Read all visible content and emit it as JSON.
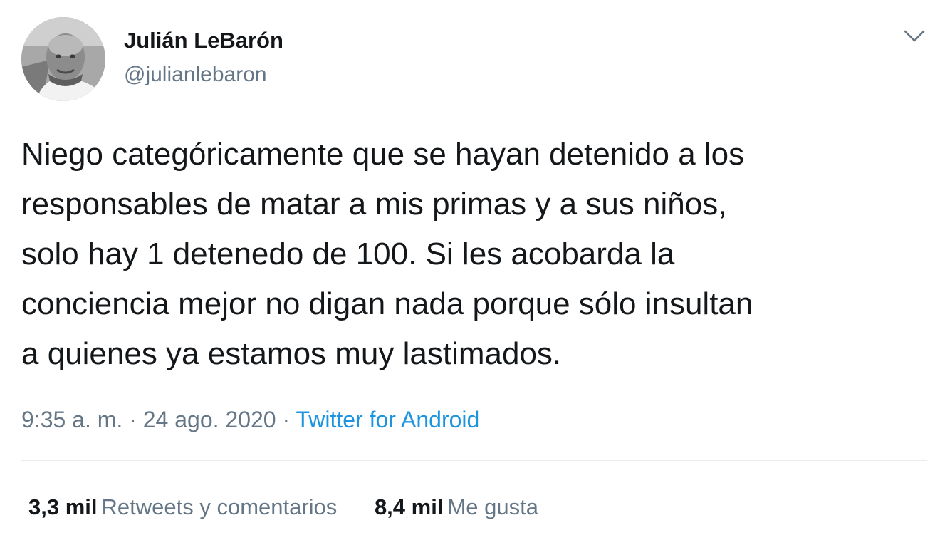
{
  "user": {
    "display_name": "Julián LeBarón",
    "handle": "@julianlebaron",
    "avatar": "profile-photo-grayscale"
  },
  "menu_icon": "chevron-down-icon",
  "tweet": {
    "text": "Niego categóricamente que se hayan detenido a los\nresponsables de matar a mis primas y a sus niños,\nsolo hay 1 detenedo de 100. Si les acobarda la\nconciencia mejor no digan nada porque sólo insultan\na quienes ya estamos muy lastimados."
  },
  "meta": {
    "time": "9:35 a. m.",
    "separator": " · ",
    "date": "24 ago. 2020",
    "source": "Twitter for Android"
  },
  "stats": {
    "retweets": {
      "count": "3,3 mil",
      "label": "Retweets y comentarios"
    },
    "likes": {
      "count": "8,4 mil",
      "label": "Me gusta"
    }
  },
  "colors": {
    "text": "#14171a",
    "secondary": "#657786",
    "link": "#1b95e0",
    "divider": "#e6ecf0"
  }
}
